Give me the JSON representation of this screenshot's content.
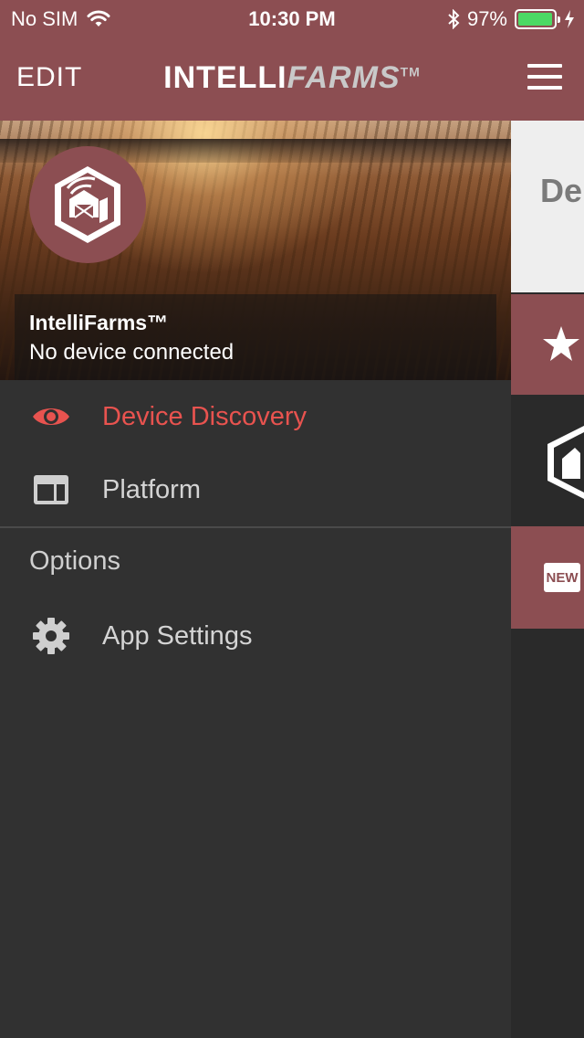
{
  "status_bar": {
    "carrier": "No SIM",
    "time": "10:30 PM",
    "battery": "97%",
    "battery_level": 0.97
  },
  "header": {
    "edit_label": "EDIT",
    "brand_part1": "INTELLI",
    "brand_part2": "FARMS",
    "brand_tm": "TM",
    "menu_icon": "hamburger-menu-icon"
  },
  "drawer": {
    "hero": {
      "title": "IntelliFarms™",
      "subtitle": "No device connected"
    },
    "items": [
      {
        "label": "Device Discovery",
        "icon": "eye-icon",
        "active": true
      },
      {
        "label": "Platform",
        "icon": "platform-icon",
        "active": false
      }
    ],
    "section_title": "Options",
    "options": [
      {
        "label": "App Settings",
        "icon": "gear-icon"
      }
    ]
  },
  "peek": {
    "tile1_text": "De",
    "tile3_badge": "NEW"
  },
  "colors": {
    "brand": "#8c4e52",
    "active": "#e8534f",
    "drawer_bg": "#313131",
    "battery": "#4cd964"
  }
}
